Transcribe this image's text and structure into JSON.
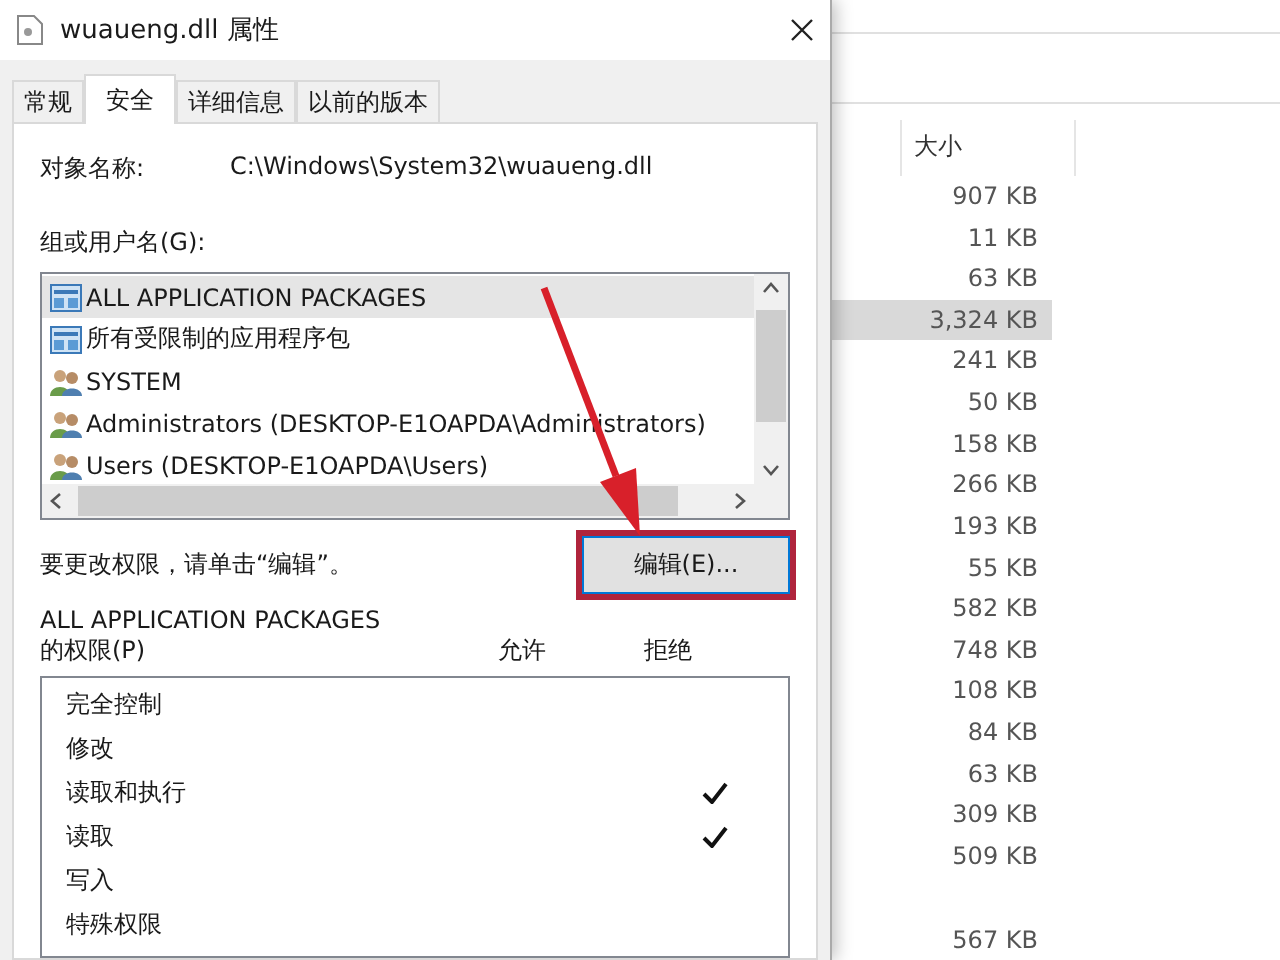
{
  "dialog": {
    "title": "wuaueng.dll 属性",
    "tabs": [
      {
        "label": "常规",
        "selected": false
      },
      {
        "label": "安全",
        "selected": true
      },
      {
        "label": "详细信息",
        "selected": false
      },
      {
        "label": "以前的版本",
        "selected": false
      }
    ],
    "object_label": "对象名称:",
    "object_value": "C:\\Windows\\System32\\wuaueng.dll",
    "groups_label": "组或用户名(G):",
    "groups": [
      {
        "name": "ALL APPLICATION PACKAGES",
        "kind": "package",
        "selected": true
      },
      {
        "name": "所有受限制的应用程序包",
        "kind": "package",
        "selected": false
      },
      {
        "name": "SYSTEM",
        "kind": "users",
        "selected": false
      },
      {
        "name": "Administrators (DESKTOP-E1OAPDA\\Administrators)",
        "kind": "users",
        "selected": false
      },
      {
        "name": "Users (DESKTOP-E1OAPDA\\Users)",
        "kind": "users",
        "selected": false
      }
    ],
    "edit_hint": "要更改权限，请单击“编辑”。",
    "edit_button": {
      "label": "编辑(E)...",
      "annotated": true
    },
    "permissions_for": "ALL APPLICATION PACKAGES",
    "permissions_label": "的权限(P)",
    "columns": [
      "允许",
      "拒绝"
    ],
    "permissions": [
      {
        "name": "完全控制",
        "allow": false,
        "deny": false
      },
      {
        "name": "修改",
        "allow": false,
        "deny": false
      },
      {
        "name": "读取和执行",
        "allow": false,
        "deny": true
      },
      {
        "name": "读取",
        "allow": false,
        "deny": true
      },
      {
        "name": "写入",
        "allow": false,
        "deny": false
      },
      {
        "name": "特殊权限",
        "allow": false,
        "deny": false
      }
    ]
  },
  "explorer": {
    "size_header": "大小",
    "sizes": [
      {
        "text": "907 KB",
        "selected": false
      },
      {
        "text": "11 KB",
        "selected": false
      },
      {
        "text": "63 KB",
        "selected": false
      },
      {
        "text": "3,324 KB",
        "selected": true
      },
      {
        "text": "241 KB",
        "selected": false
      },
      {
        "text": "50 KB",
        "selected": false
      },
      {
        "text": "158 KB",
        "selected": false
      },
      {
        "text": "266 KB",
        "selected": false
      },
      {
        "text": "193 KB",
        "selected": false
      },
      {
        "text": "55 KB",
        "selected": false
      },
      {
        "text": "582 KB",
        "selected": false
      },
      {
        "text": "748 KB",
        "selected": false
      },
      {
        "text": "108 KB",
        "selected": false
      },
      {
        "text": "84 KB",
        "selected": false
      },
      {
        "text": "63 KB",
        "selected": false
      },
      {
        "text": "309 KB",
        "selected": false
      },
      {
        "text": "509 KB",
        "selected": false
      }
    ],
    "last_size": "567 KB"
  }
}
